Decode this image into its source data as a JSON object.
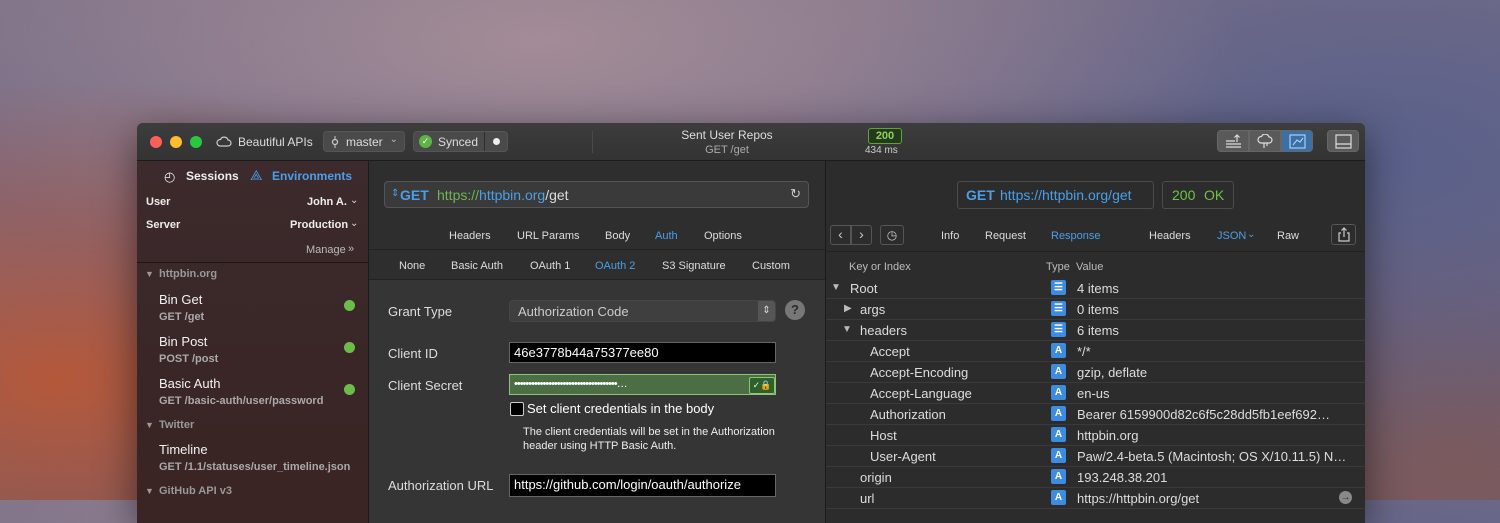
{
  "titlebar": {
    "project": "Beautiful APIs",
    "branch": "master",
    "sync_status": "Synced",
    "request_title": "Sent User Repos",
    "request_sub": "GET /get",
    "status_code": "200",
    "duration": "434 ms"
  },
  "sidebar": {
    "sessions_label": "Sessions",
    "environments_label": "Environments",
    "user_label": "User",
    "user_value": "John A.",
    "server_label": "Server",
    "server_value": "Production",
    "manage_label": "Manage",
    "groups": [
      {
        "name": "httpbin.org"
      },
      {
        "name": "Twitter"
      },
      {
        "name": "GitHub API v3"
      }
    ],
    "items": [
      {
        "title": "Bin Get",
        "sub": "GET /get"
      },
      {
        "title": "Bin Post",
        "sub": "POST /post"
      },
      {
        "title": "Basic Auth",
        "sub": "GET /basic-auth/user/password"
      },
      {
        "title": "Timeline",
        "sub": "GET /1.1/statuses/user_timeline.json"
      }
    ]
  },
  "request": {
    "method": "GET",
    "url_scheme": "https://",
    "url_host": "httpbin.org",
    "url_path": "/get",
    "tabs": [
      "Headers",
      "URL Params",
      "Body",
      "Auth",
      "Options"
    ],
    "auth_tabs": [
      "None",
      "Basic Auth",
      "OAuth 1",
      "OAuth 2",
      "S3 Signature",
      "Custom"
    ],
    "grant_type_label": "Grant Type",
    "grant_type_value": "Authorization Code",
    "client_id_label": "Client ID",
    "client_id_value": "46e3778b44a75377ee80",
    "client_secret_label": "Client Secret",
    "client_secret_value": "••••••••••••••••••••••••••••••••••••…",
    "checkbox_label": "Set client credentials in the body",
    "help_text_1": "The client credentials will be set in the Authorization",
    "help_text_2": "header using HTTP Basic Auth.",
    "auth_url_label": "Authorization URL",
    "auth_url_value": "https://github.com/login/oauth/authorize"
  },
  "response": {
    "method": "GET",
    "url": "https://httpbin.org/get",
    "status_code": "200",
    "status_text": "OK",
    "tabs": [
      "Info",
      "Request",
      "Response"
    ],
    "sub_tabs": [
      "Headers",
      "JSON",
      "Raw"
    ],
    "col_key": "Key or Index",
    "col_type": "Type",
    "col_value": "Value",
    "rows": [
      {
        "key": "Root",
        "type": "list",
        "value": "4 items"
      },
      {
        "key": "args",
        "type": "list",
        "value": "0 items"
      },
      {
        "key": "headers",
        "type": "list",
        "value": "6 items"
      },
      {
        "key": "Accept",
        "type": "A",
        "value": "*/*"
      },
      {
        "key": "Accept-Encoding",
        "type": "A",
        "value": "gzip, deflate"
      },
      {
        "key": "Accept-Language",
        "type": "A",
        "value": "en-us"
      },
      {
        "key": "Authorization",
        "type": "A",
        "value": "Bearer 6159900d82c6f5c28dd5fb1eef692…"
      },
      {
        "key": "Host",
        "type": "A",
        "value": "httpbin.org"
      },
      {
        "key": "User-Agent",
        "type": "A",
        "value": "Paw/2.4-beta.5 (Macintosh; OS X/10.11.5) N…"
      },
      {
        "key": "origin",
        "type": "A",
        "value": "193.248.38.201"
      },
      {
        "key": "url",
        "type": "A",
        "value": "https://httpbin.org/get"
      }
    ]
  },
  "colors": {
    "accent": "#4a9fe8",
    "green": "#6dbc4a",
    "status_green": "#8ed35f"
  }
}
